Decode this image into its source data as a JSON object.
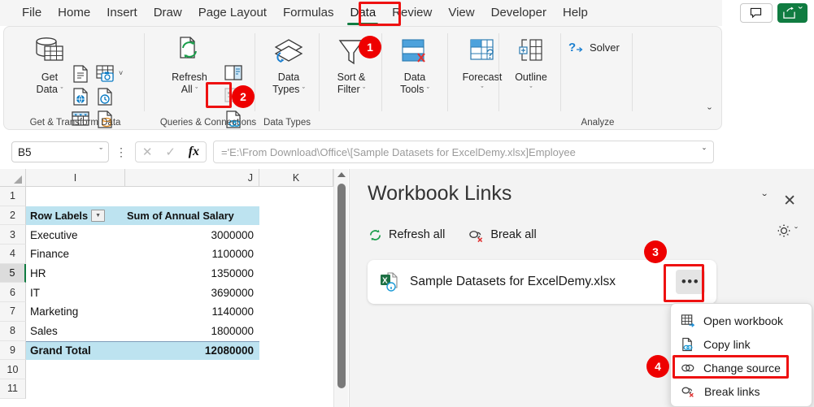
{
  "ribbon": {
    "tabs": [
      {
        "label": "File",
        "active": false
      },
      {
        "label": "Home",
        "active": false
      },
      {
        "label": "Insert",
        "active": false
      },
      {
        "label": "Draw",
        "active": false
      },
      {
        "label": "Page Layout",
        "active": false
      },
      {
        "label": "Formulas",
        "active": false
      },
      {
        "label": "Data",
        "active": true
      },
      {
        "label": "Review",
        "active": false
      },
      {
        "label": "View",
        "active": false
      },
      {
        "label": "Developer",
        "active": false
      },
      {
        "label": "Help",
        "active": false
      }
    ],
    "comment_icon": "comment-icon",
    "share_icon": "share-icon",
    "share_caret": "ˇ",
    "groups": [
      {
        "name": "Get & Transform Data",
        "label": "Get & Transform Data"
      },
      {
        "name": "Queries & Connections",
        "label": "Queries & Connections"
      },
      {
        "name": "Data Types",
        "label": "Data Types"
      },
      {
        "name": "Analyze",
        "label": "Analyze"
      }
    ],
    "buttons": {
      "get_data": "Get\nData",
      "get_data_line1": "Get",
      "get_data_line2": "Data",
      "refresh_all_line1": "Refresh",
      "refresh_all_line2": "All",
      "data_types_line1": "Data",
      "data_types_line2": "Types",
      "sort_filter_line1": "Sort &",
      "sort_filter_line2": "Filter",
      "data_tools_line1": "Data",
      "data_tools_line2": "Tools",
      "forecast": "Forecast",
      "outline": "Outline",
      "solver": "Solver"
    },
    "expand_caret": "ˇ"
  },
  "formula_bar": {
    "name_box_value": "B5",
    "name_box_caret": "ˇ",
    "cancel_icon": "cancel-icon",
    "confirm_icon": "confirm-icon",
    "fx_label": "fx",
    "formula": "='E:\\From Download\\Office\\[Sample Datasets for ExcelDemy.xlsx]Employee",
    "expand_caret": "ˇ"
  },
  "grid": {
    "columns": [
      "I",
      "J",
      "K"
    ],
    "rows": [
      "1",
      "2",
      "3",
      "4",
      "5",
      "6",
      "7",
      "8",
      "9",
      "10",
      "11"
    ],
    "selected_row": "5",
    "pivot": {
      "header": {
        "row_labels": "Row Labels",
        "value_field": "Sum of Annual Salary",
        "filter_icon": "filter-dropdown-icon"
      },
      "data": [
        {
          "label": "Executive",
          "value": "3000000"
        },
        {
          "label": "Finance",
          "value": "1100000"
        },
        {
          "label": "HR",
          "value": "1350000"
        },
        {
          "label": "IT",
          "value": "3690000"
        },
        {
          "label": "Marketing",
          "value": "1140000"
        },
        {
          "label": "Sales",
          "value": "1800000"
        }
      ],
      "total": {
        "label": "Grand Total",
        "value": "12080000"
      },
      "header_bg": "#bde3f0"
    }
  },
  "pane": {
    "title": "Workbook Links",
    "collapse_caret": "ˇ",
    "close_glyph": "✕",
    "refresh_all": "Refresh all",
    "break_all": "Break all",
    "settings_icon": "gear-icon",
    "settings_caret": "ˇ",
    "link": {
      "name": "Sample Datasets for ExcelDemy.xlsx",
      "icon": "excel-file-info-icon",
      "more_glyph": "•••"
    }
  },
  "context_menu": {
    "items": [
      {
        "label": "Open workbook",
        "icon": "open-workbook-icon"
      },
      {
        "label": "Copy link",
        "icon": "copy-link-icon"
      },
      {
        "label": "Change source",
        "icon": "change-source-icon",
        "highlighted": true
      },
      {
        "label": "Break links",
        "icon": "break-links-icon"
      }
    ]
  },
  "annotations": {
    "badges": [
      {
        "number": "1"
      },
      {
        "number": "2"
      },
      {
        "number": "3"
      },
      {
        "number": "4"
      }
    ],
    "accent_color": "#ee0000",
    "highlight_color": "#107c41"
  }
}
